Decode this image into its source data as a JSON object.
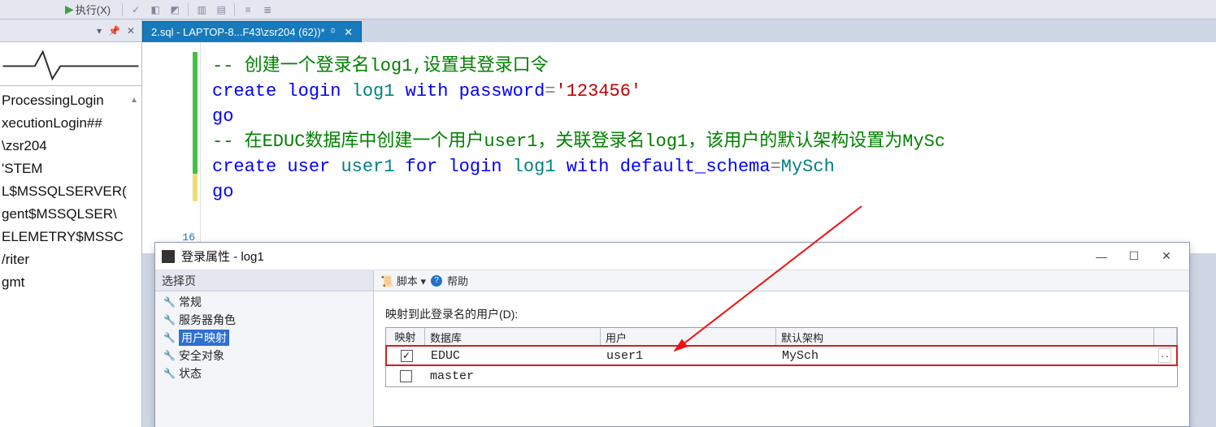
{
  "toolbar": {
    "run_label": "执行(X)"
  },
  "left_panel": {
    "items": [
      "ProcessingLogin",
      "xecutionLogin##",
      "\\zsr204",
      "",
      "'STEM",
      "L$MSSQLSERVER(",
      "gent$MSSQLSER\\",
      "ELEMETRY$MSSC",
      "/riter",
      "gmt"
    ]
  },
  "tab": {
    "title": "2.sql - LAPTOP-8...F43\\zsr204 (62))*"
  },
  "code": {
    "l1_comment": "-- 创建一个登录名log1,设置其登录口令",
    "l2_a": "create",
    "l2_b": "login",
    "l2_c": "log1",
    "l2_d": "with",
    "l2_e": "password",
    "l2_eq": "=",
    "l2_f": "'123456'",
    "l3": "go",
    "l4_comment": "-- 在EDUC数据库中创建一个用户user1，关联登录名log1，该用户的默认架构设置为MySc",
    "l5_a": "create",
    "l5_b": "user",
    "l5_c": "user1",
    "l5_d": "for",
    "l5_e": "login",
    "l5_f": "log1",
    "l5_g": "with",
    "l5_h": "default_schema",
    "l5_eq": "=",
    "l5_i": "MySch",
    "l6": "go",
    "lnum": "16"
  },
  "dialog": {
    "title": "登录属性 - log1",
    "nav_title": "选择页",
    "nav_items": [
      "常规",
      "服务器角色",
      "用户映射",
      "安全对象",
      "状态"
    ],
    "nav_selected_index": 2,
    "script_btn": "脚本",
    "help_btn": "帮助",
    "map_caption": "映射到此登录名的用户(D):",
    "cols": {
      "map": "映射",
      "db": "数据库",
      "user": "用户",
      "schema": "默认架构"
    },
    "rows": [
      {
        "checked": true,
        "db": "EDUC",
        "user": "user1",
        "schema": "MySch",
        "highlight": true,
        "ellipsis": true
      },
      {
        "checked": false,
        "db": "master",
        "user": "",
        "schema": "",
        "highlight": false,
        "ellipsis": false
      }
    ],
    "ellipsis_label": ".."
  }
}
